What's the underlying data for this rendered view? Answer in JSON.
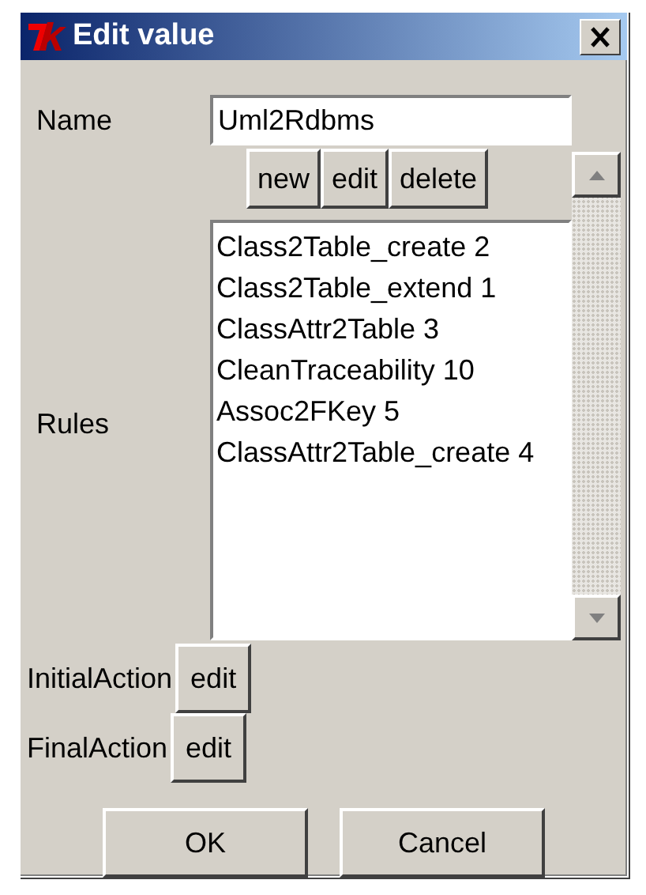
{
  "window": {
    "title": "Edit value"
  },
  "name": {
    "label": "Name",
    "value": "Uml2Rdbms"
  },
  "rule_buttons": [
    "new",
    "edit",
    "delete"
  ],
  "rules": {
    "label": "Rules",
    "items": [
      "Class2Table_create 2",
      "Class2Table_extend 1",
      "ClassAttr2Table 3",
      "CleanTraceability 10",
      "Assoc2FKey 5",
      "ClassAttr2Table_create 4"
    ]
  },
  "actions": [
    {
      "label": "InitialAction",
      "button": "edit"
    },
    {
      "label": "FinalAction",
      "button": "edit"
    }
  ],
  "buttons": [
    "OK",
    "Cancel"
  ]
}
